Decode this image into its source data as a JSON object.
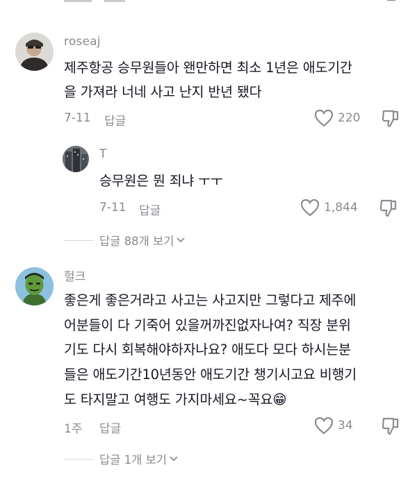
{
  "comments": [
    {
      "username": "roseaj",
      "text": "제주항공 승무원들아 왠만하면 최소 1년은 애도기간을 가져라 너네 사고 난지 반년 됐다",
      "lines": [
        "제주항공 승무원들아 왠만하면 최소 1년은 애도기간",
        "을 가져라 너네 사고 난지 반년 됐다"
      ],
      "date": "7-11",
      "reply_label": "답글",
      "likes": "220",
      "replies": [
        {
          "username": "T",
          "text": "승무원은 뭔 죄냐 ㅜㅜ",
          "date": "7-11",
          "reply_label": "답글",
          "likes": "1,844"
        }
      ],
      "more_replies": "답글 88개 보기"
    },
    {
      "username": "헐크",
      "lines": [
        "좋은게 좋은거라고 사고는 사고지만 그렇다고 제주에",
        "어분들이 다 기죽어 있을꺼까진없자나여? 직장 분위",
        "기도 다시 회복해야하자나요? 애도다 모다 하시는분",
        "들은 애도기간10년동안 애도기간 챙기시고요 비행기",
        "도 타지말고 여행도 가지마세요~꼭요😁"
      ],
      "date": "1주",
      "reply_label": "답글",
      "likes": "34",
      "more_replies": "답글 1개 보기"
    }
  ],
  "icons": {
    "like": "heart-outline-icon",
    "dislike": "thumbs-down-outline-icon",
    "chevron": "chevron-down-icon"
  },
  "colors": {
    "text": "#161823",
    "muted": "#8a8b91",
    "divider": "#d8d8da"
  }
}
